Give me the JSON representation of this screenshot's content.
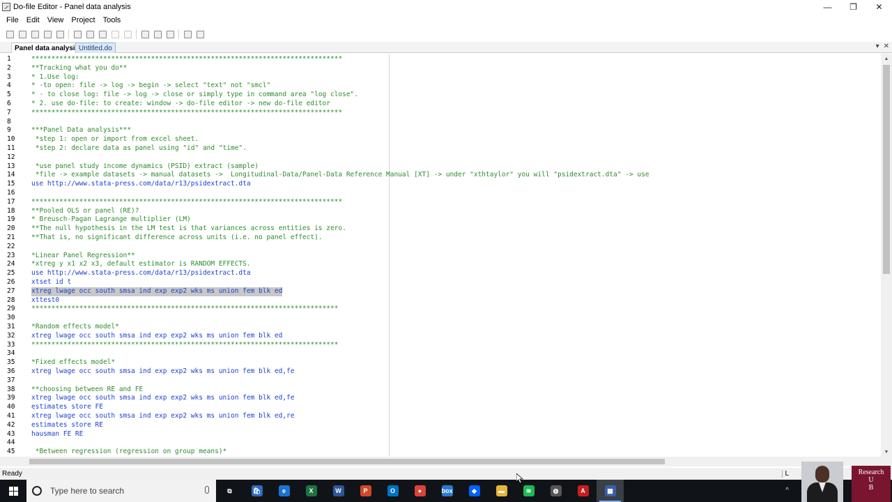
{
  "window": {
    "title": "Do-file Editor - Panel data analysis",
    "controls": {
      "minimize": "—",
      "restore": "❐",
      "close": "✕"
    }
  },
  "menu": [
    "File",
    "Edit",
    "View",
    "Project",
    "Tools"
  ],
  "tabs": [
    {
      "label": "Panel data analysis",
      "active": true
    },
    {
      "label": "Untitled.do",
      "active": false
    }
  ],
  "tab_tools": {
    "dropdown": "▾",
    "close": "✕"
  },
  "editor": {
    "lines": [
      {
        "n": "1",
        "text": "******************************************************************************",
        "style": "cmt"
      },
      {
        "n": "2",
        "text": "**Tracking what you do**",
        "style": "cmt"
      },
      {
        "n": "3",
        "text": "* 1.Use log:",
        "style": "cmt"
      },
      {
        "n": "4",
        "text": "* -to open: file -> log -> begin -> select \"text\" not \"smcl\"",
        "style": "cmt"
      },
      {
        "n": "5",
        "text": "* - to close log: file -> log -> close or simply type in command area \"log close\".",
        "style": "cmt"
      },
      {
        "n": "6",
        "text": "* 2. use do-file: to create: window -> do-file editor -> new do-file editor",
        "style": "cmt"
      },
      {
        "n": "7",
        "text": "******************************************************************************",
        "style": "cmt"
      },
      {
        "n": "8",
        "text": "",
        "style": "plain"
      },
      {
        "n": "9",
        "text": "***Panel Data analysis***",
        "style": "cmt"
      },
      {
        "n": "10",
        "text": " *step 1: open or import from excel sheet.",
        "style": "cmt"
      },
      {
        "n": "11",
        "text": " *step 2: declare data as panel using \"id\" and \"time\".",
        "style": "cmt"
      },
      {
        "n": "12",
        "text": "",
        "style": "plain"
      },
      {
        "n": "13",
        "text": " *use panel study income dynamics (PSID) extract (sample)",
        "style": "cmt"
      },
      {
        "n": "14",
        "text": " *file -> example datasets -> manual datasets ->  Longitudinal-Data/Panel-Data Reference Manual [XT] -> under \"xthtaylor\" you will \"psidextract.dta\" -> use",
        "style": "cmt"
      },
      {
        "n": "15",
        "text": "use http://www.stata-press.com/data/r13/psidextract.dta",
        "style": "cmd"
      },
      {
        "n": "16",
        "text": "",
        "style": "plain"
      },
      {
        "n": "17",
        "text": "******************************************************************************",
        "style": "cmt"
      },
      {
        "n": "18",
        "text": "**Pooled OLS or panel (RE)?",
        "style": "cmt"
      },
      {
        "n": "19",
        "text": "* Breusch-Pagan Lagrange multiplier (LM)",
        "style": "cmt"
      },
      {
        "n": "20",
        "text": "**The null hypothesis in the LM test is that variances across entities is zero.",
        "style": "cmt"
      },
      {
        "n": "21",
        "text": "**That is, no significant difference across units (i.e. no panel effect).",
        "style": "cmt"
      },
      {
        "n": "22",
        "text": "",
        "style": "plain"
      },
      {
        "n": "23",
        "text": "*Linear Panel Regression**",
        "style": "cmt"
      },
      {
        "n": "24",
        "text": "*xtreg y x1 x2 x3, default estimator is RANDOM EFFECTS.",
        "style": "cmt"
      },
      {
        "n": "25",
        "text": "use http://www.stata-press.com/data/r13/psidextract.dta",
        "style": "cmd"
      },
      {
        "n": "26",
        "text": "xtset id t",
        "style": "cmd"
      },
      {
        "n": "27",
        "text": "xtreg lwage occ south smsa ind exp exp2 wks ms union fem blk ed",
        "style": "cmd",
        "highlight": true
      },
      {
        "n": "28",
        "text": "xttest0",
        "style": "cmd"
      },
      {
        "n": "29",
        "text": "*****************************************************************************",
        "style": "cmt"
      },
      {
        "n": "30",
        "text": "",
        "style": "plain"
      },
      {
        "n": "31",
        "text": "*Random effects model*",
        "style": "cmt"
      },
      {
        "n": "32",
        "text": "xtreg lwage occ south smsa ind exp exp2 wks ms union fem blk ed",
        "style": "cmd"
      },
      {
        "n": "33",
        "text": "*****************************************************************************",
        "style": "cmt"
      },
      {
        "n": "34",
        "text": "",
        "style": "plain"
      },
      {
        "n": "35",
        "text": "*Fixed effects model*",
        "style": "cmt"
      },
      {
        "n": "36",
        "text": "xtreg lwage occ south smsa ind exp exp2 wks ms union fem blk ed,fe",
        "style": "cmd"
      },
      {
        "n": "37",
        "text": "",
        "style": "plain"
      },
      {
        "n": "38",
        "text": "**choosing between RE and FE",
        "style": "cmt"
      },
      {
        "n": "39",
        "text": "xtreg lwage occ south smsa ind exp exp2 wks ms union fem blk ed,fe",
        "style": "cmd"
      },
      {
        "n": "40",
        "text": "estimates store FE",
        "style": "cmd"
      },
      {
        "n": "41",
        "text": "xtreg lwage occ south smsa ind exp exp2 wks ms union fem blk ed,re",
        "style": "cmd"
      },
      {
        "n": "42",
        "text": "estimates store RE",
        "style": "cmd"
      },
      {
        "n": "43",
        "text": "hausman FE RE",
        "style": "cmd"
      },
      {
        "n": "44",
        "text": "",
        "style": "plain"
      },
      {
        "n": "45",
        "text": " *Between regression (regression on group means)*",
        "style": "cmt"
      }
    ]
  },
  "status": {
    "left": "Ready",
    "right": "L"
  },
  "taskbar": {
    "search_placeholder": "Type here to search",
    "apps": [
      {
        "name": "task-view",
        "label": "⧉",
        "color": "#101418"
      },
      {
        "name": "store",
        "label": "🛍",
        "color": "#2d6cc0"
      },
      {
        "name": "edge",
        "label": "e",
        "color": "#1a73d1"
      },
      {
        "name": "excel",
        "label": "X",
        "color": "#1e7145"
      },
      {
        "name": "word",
        "label": "W",
        "color": "#2b579a"
      },
      {
        "name": "powerpoint",
        "label": "P",
        "color": "#d24726"
      },
      {
        "name": "outlook",
        "label": "O",
        "color": "#0072c6"
      },
      {
        "name": "chrome",
        "label": "●",
        "color": "#db4437"
      },
      {
        "name": "box",
        "label": "box",
        "color": "#2a7ad2"
      },
      {
        "name": "dropbox",
        "label": "◆",
        "color": "#0061fe"
      },
      {
        "name": "file-explorer",
        "label": "▬",
        "color": "#e8b33a"
      },
      {
        "name": "spotify",
        "label": "≋",
        "color": "#1db954"
      },
      {
        "name": "camera",
        "label": "◍",
        "color": "#555555"
      },
      {
        "name": "acrobat",
        "label": "A",
        "color": "#c81e1e"
      },
      {
        "name": "stata",
        "label": "▦",
        "color": "#3a5fa8"
      }
    ],
    "tray_caret": "^"
  },
  "brand": {
    "line1": "Research",
    "line2": "U",
    "line3": "B"
  }
}
